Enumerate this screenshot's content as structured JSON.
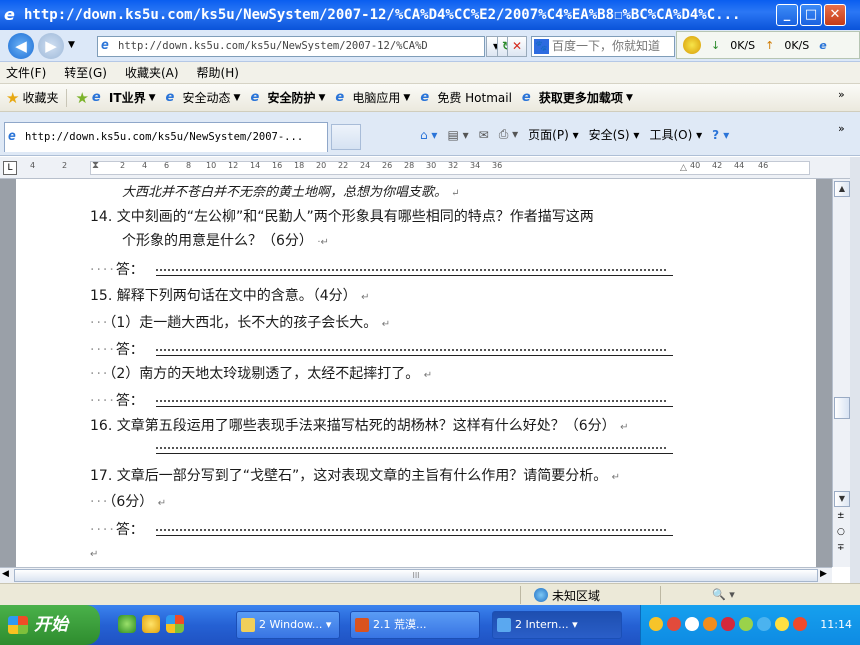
{
  "window": {
    "title": "http://down.ks5u.com/ks5u/NewSystem/2007-12/%CA%D4%CC%E2/2007%C4%EA%B8☐%BC%CA%D4%C..."
  },
  "address": {
    "url": "http://down.ks5u.com/ks5u/NewSystem/2007-12/%CA%D",
    "search_placeholder": "百度一下，你就知道"
  },
  "netmon": {
    "down": "0K/S",
    "up": "0K/S"
  },
  "menubar": {
    "items": [
      "文件(F)",
      "转至(G)",
      "收藏夹(A)",
      "帮助(H)"
    ]
  },
  "favorites": {
    "label": "收藏夹",
    "items": [
      {
        "label": "IT业界",
        "bold": true,
        "dropdown": true
      },
      {
        "label": "安全动态",
        "bold": false,
        "dropdown": true
      },
      {
        "label": "安全防护",
        "bold": true,
        "dropdown": true
      },
      {
        "label": "电脑应用",
        "bold": false,
        "dropdown": true
      },
      {
        "label": "免费 Hotmail",
        "bold": false,
        "dropdown": false
      },
      {
        "label": "获取更多加载项",
        "bold": true,
        "dropdown": true
      }
    ]
  },
  "tab": {
    "label": "http://down.ks5u.com/ks5u/NewSystem/2007-..."
  },
  "commandbar": {
    "page": "页面(P)",
    "safety": "安全(S)",
    "tools": "工具(O)"
  },
  "ruler": {
    "left_ticks": [
      "4",
      "2"
    ],
    "ticks": [
      "2",
      "4",
      "6",
      "8",
      "10",
      "12",
      "14",
      "16",
      "18",
      "20",
      "22",
      "24",
      "26",
      "28",
      "30",
      "32",
      "34",
      "36",
      "40",
      "42",
      "44",
      "46"
    ]
  },
  "document": {
    "lines": [
      {
        "text": "大西北并不苍白并不无奈的黄土地啊，总想为你唱支歌。"
      },
      {
        "text": "14. 文中刻画的“左公柳”和“民勤人”两个形象具有哪些相同的特点？作者描写这两"
      },
      {
        "text": "个形象的用意是什么？（6分）"
      },
      {
        "text": "答："
      },
      {
        "text": "15. 解释下列两句话在文中的含意。（4分）"
      },
      {
        "text": "（1）走一趟大西北，长不大的孩子会长大。"
      },
      {
        "text": "答："
      },
      {
        "text": "（2）南方的天地太玲珑剔透了，太经不起摔打了。"
      },
      {
        "text": "答："
      },
      {
        "text": "16. 文章第五段运用了哪些表现手法来描写枯死的胡杨林？这样有什么好处？（6分）"
      },
      {
        "text": "17. 文章后一部分写到了“戈壁石”，这对表现文章的主旨有什么作用？请简要分析。"
      },
      {
        "text": "（6分）"
      },
      {
        "text": "答："
      }
    ]
  },
  "statusbar": {
    "zone": "未知区域"
  },
  "taskbar": {
    "start": "开始",
    "tasks": [
      {
        "label": "2 Window..."
      },
      {
        "label": "2.1 荒漠..."
      },
      {
        "label": "2 Intern..."
      }
    ],
    "clock": "11:14"
  }
}
